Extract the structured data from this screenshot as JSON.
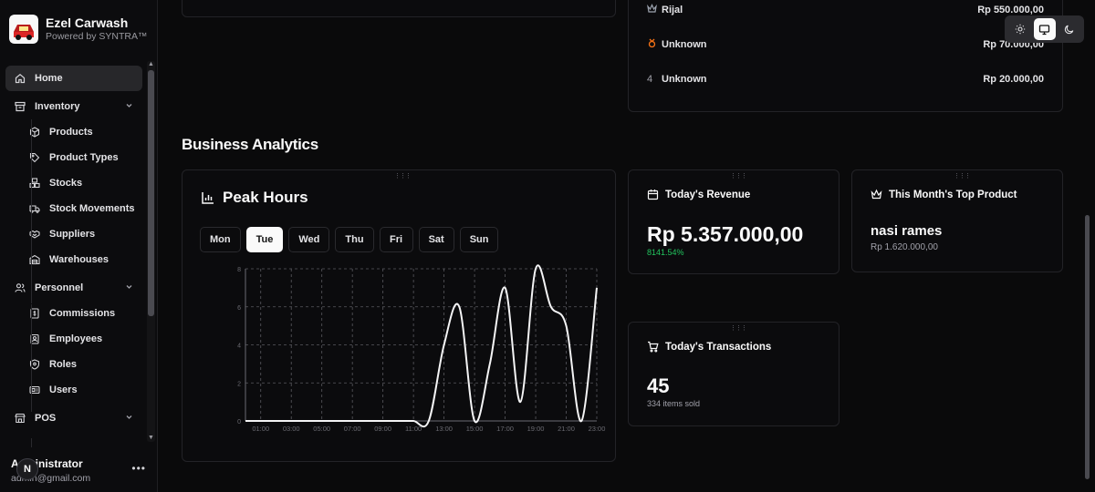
{
  "brand": {
    "name": "Ezel Carwash",
    "subtitle": "Powered by SYNTRA™"
  },
  "nav": {
    "home": "Home",
    "inventory": "Inventory",
    "products": "Products",
    "product_types": "Product Types",
    "stocks": "Stocks",
    "stock_movements": "Stock Movements",
    "suppliers": "Suppliers",
    "warehouses": "Warehouses",
    "personnel": "Personnel",
    "commissions": "Commissions",
    "employees": "Employees",
    "roles": "Roles",
    "users": "Users",
    "pos": "POS"
  },
  "user": {
    "name": "Administrator",
    "email": "admin@gmail.com",
    "avatar_letter": "N"
  },
  "top_list": {
    "rows": [
      {
        "rank": "",
        "name": "Rijal",
        "amount": "Rp 550.000,00"
      },
      {
        "rank": "",
        "name": "Unknown",
        "amount": "Rp 70.000,00"
      },
      {
        "rank": "4",
        "name": "Unknown",
        "amount": "Rp 20.000,00"
      }
    ]
  },
  "section_title": "Business Analytics",
  "peak_hours": {
    "title": "Peak Hours",
    "days": [
      "Mon",
      "Tue",
      "Wed",
      "Thu",
      "Fri",
      "Sat",
      "Sun"
    ],
    "selected_day": "Tue"
  },
  "chart_data": {
    "type": "line",
    "x": [
      "00:00",
      "01:00",
      "02:00",
      "03:00",
      "04:00",
      "05:00",
      "06:00",
      "07:00",
      "08:00",
      "09:00",
      "10:00",
      "11:00",
      "12:00",
      "13:00",
      "14:00",
      "15:00",
      "16:00",
      "17:00",
      "18:00",
      "19:00",
      "20:00",
      "21:00",
      "22:00",
      "23:00"
    ],
    "xticks": [
      "01:00",
      "03:00",
      "05:00",
      "07:00",
      "09:00",
      "11:00",
      "13:00",
      "15:00",
      "17:00",
      "19:00",
      "21:00",
      "23:00"
    ],
    "values": [
      0,
      0,
      0,
      0,
      0,
      0,
      0,
      0,
      0,
      0,
      0,
      0,
      0,
      4,
      6,
      0,
      3,
      7,
      1,
      8,
      6,
      5,
      0,
      7
    ],
    "ylim": [
      0,
      8
    ],
    "yticks": [
      "0",
      "2",
      "4",
      "6",
      "8"
    ],
    "grid": true,
    "line_color": "#f4f4f5"
  },
  "revenue": {
    "title": "Today's Revenue",
    "value": "Rp 5.357.000,00",
    "change": "8141.54%",
    "change_color": "#22c55e"
  },
  "top_product": {
    "title": "This Month's Top Product",
    "name": "nasi rames",
    "amount": "Rp 1.620.000,00"
  },
  "transactions": {
    "title": "Today's Transactions",
    "count": "45",
    "sub": "334 items sold"
  },
  "theme": {
    "options": [
      "light",
      "system",
      "dark"
    ],
    "selected": "system"
  }
}
